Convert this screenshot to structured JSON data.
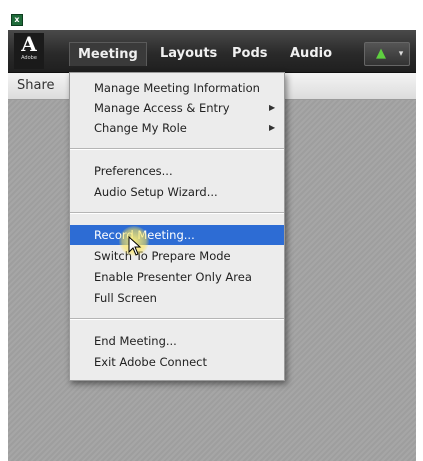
{
  "titlebar": {
    "app_icon": "excel-icon"
  },
  "logo": {
    "mark": "A",
    "text": "Adobe"
  },
  "menubar": {
    "items": [
      {
        "label": "Meeting",
        "active": true
      },
      {
        "label": "Layouts",
        "active": false
      },
      {
        "label": "Pods",
        "active": false
      },
      {
        "label": "Audio",
        "active": false
      }
    ],
    "audio_icon": "speaker-icon",
    "audio_chevron": "▾"
  },
  "share_bar": {
    "label": "Share"
  },
  "dropdown": {
    "groups": [
      [
        {
          "label": "Manage Meeting Information",
          "submenu": false
        },
        {
          "label": "Manage Access & Entry",
          "submenu": true
        },
        {
          "label": "Change My Role",
          "submenu": true
        }
      ],
      [
        {
          "label": "Preferences...",
          "submenu": false
        },
        {
          "label": "Audio Setup Wizard...",
          "submenu": false
        }
      ],
      [
        {
          "label": "Record Meeting...",
          "submenu": false,
          "highlighted": true
        },
        {
          "label": "Switch To Prepare Mode",
          "submenu": false
        },
        {
          "label": "Enable Presenter Only Area",
          "submenu": false
        },
        {
          "label": "Full Screen",
          "submenu": false
        }
      ],
      [
        {
          "label": "End Meeting...",
          "submenu": false
        },
        {
          "label": "Exit Adobe Connect",
          "submenu": false
        }
      ]
    ],
    "submenu_arrow": "▶"
  },
  "colors": {
    "highlight": "#2d6cd4",
    "speaker": "#5fd040",
    "cursor_glow": "#ffe878"
  }
}
